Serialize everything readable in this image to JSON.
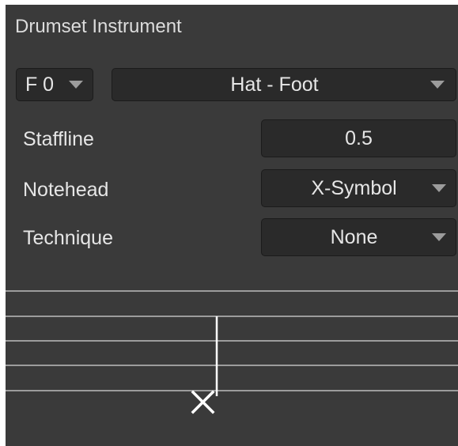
{
  "panel": {
    "title": "Drumset Instrument"
  },
  "pitch_select": {
    "value": "F 0",
    "icon": "chevron-down-icon"
  },
  "instrument_select": {
    "value": "Hat - Foot",
    "icon": "chevron-down-icon"
  },
  "staffline": {
    "label": "Staffline",
    "value": "0.5"
  },
  "notehead": {
    "label": "Notehead",
    "value": "X-Symbol",
    "icon": "chevron-down-icon"
  },
  "technique": {
    "label": "Technique",
    "value": "None",
    "icon": "chevron-down-icon"
  },
  "preview": {
    "notehead_icon": "x-notehead-icon"
  },
  "colors": {
    "panel_bg": "#3a3a3a",
    "field_bg": "#2a2a2a",
    "text": "#e6e6e6",
    "staff_line": "#bdbdbd",
    "arrow": "#9c9c9c"
  }
}
